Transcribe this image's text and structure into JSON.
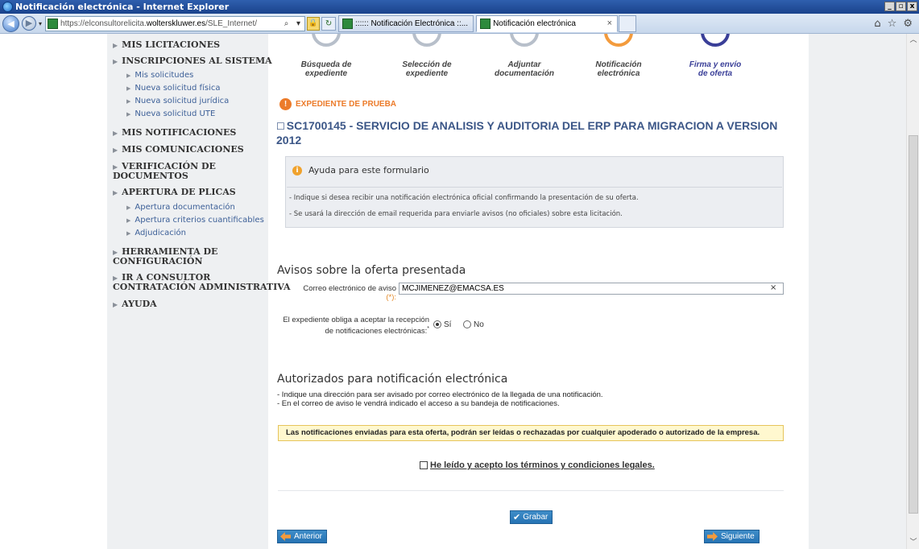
{
  "window": {
    "title": "Notificación electrónica - Internet Explorer",
    "buttons": [
      "_",
      "▫",
      "x"
    ]
  },
  "browser": {
    "url_prefix": "https://elconsultorelicita.",
    "url_domain": "wolterskluwer.es",
    "url_suffix": "/SLE_Internet/",
    "tabs": [
      {
        "label": ":::::: Notificación Electrónica ::..."
      },
      {
        "label": "Notificación electrónica"
      }
    ],
    "tab_close": "×"
  },
  "sidebar": {
    "items": [
      {
        "label": "MIS LICITACIONES"
      },
      {
        "label": "INSCRIPCIONES AL SISTEMA"
      },
      {
        "label": "MIS NOTIFICACIONES"
      },
      {
        "label": "MIS COMUNICACIONES"
      },
      {
        "label_line1": "VERIFICACIÓN DE",
        "label_line2": "DOCUMENTOS"
      },
      {
        "label": "APERTURA DE PLICAS"
      },
      {
        "label_line1": "HERRAMIENTA DE",
        "label_line2": "CONFIGURACIÓN"
      },
      {
        "label_line1": "IR A CONSULTOR",
        "label_line2": "CONTRATACIÓN ADMINISTRATIVA"
      },
      {
        "label": "AYUDA"
      }
    ],
    "inscripciones_sub": [
      "Mis solicitudes",
      "Nueva solicitud física",
      "Nueva solicitud jurídica",
      "Nueva solicitud UTE"
    ],
    "apertura_sub": [
      "Apertura documentación",
      "Apertura criterios cuantificables",
      "Adjudicación"
    ]
  },
  "steps": [
    {
      "line1": "Búsqueda de",
      "line2": "expediente"
    },
    {
      "line1": "Selección de",
      "line2": "expediente"
    },
    {
      "line1": "Adjuntar",
      "line2": "documentación"
    },
    {
      "line1": "Notificación",
      "line2": "electrónica"
    },
    {
      "line1": "Firma y envío",
      "line2": "de oferta"
    }
  ],
  "expediente": {
    "warning": "EXPEDIENTE DE PRUEBA",
    "title_line1": "SC1700145  -  SERVICIO DE ANALISIS Y AUDITORIA DEL ERP PARA MIGRACION A VERSION",
    "title_line2": "2012"
  },
  "help": {
    "title": "Ayuda para este formulario",
    "line1": "- Indique si desea recibir una notificación electrónica oficial confirmando la presentación de su oferta.",
    "line2": "- Se usará la dirección de email requerida para enviarle avisos (no oficiales) sobre esta licitación."
  },
  "avisos": {
    "title": "Avisos sobre la oferta presentada",
    "email_label": "Correo electrónico de aviso",
    "required_mark": "(*):",
    "email_value": "MCJIMENEZ@EMACSA.ES",
    "clear": "×",
    "radio_label_line1": "El expediente obliga a aceptar la recepción",
    "radio_label_line2": "de notificaciones electrónicas:",
    "radio_mark": "*",
    "radio_yes": "Sí",
    "radio_no": "No",
    "selected": "Sí"
  },
  "autorizados": {
    "title": "Autorizados para notificación electrónica",
    "line1": "- Indique una dirección para ser avisado por correo electrónico de la llegada de una notificación.",
    "line2": "- En el correo de aviso le vendrá indicado el acceso a su bandeja de notificaciones.",
    "note": "Las notificaciones enviadas para esta oferta, podrán ser leídas o rechazadas por cualquier apoderado o autorizado de la empresa.",
    "terms": "He leído y acepto los términos y condiciones legales."
  },
  "actions": {
    "save": "Grabar",
    "previous": "Anterior",
    "next": "Siguiente"
  },
  "colors": {
    "accent_orange": "#f39b3d",
    "accent_blue": "#3a3f98",
    "button_blue": "#2673b4",
    "link_blue": "#3d6098"
  }
}
